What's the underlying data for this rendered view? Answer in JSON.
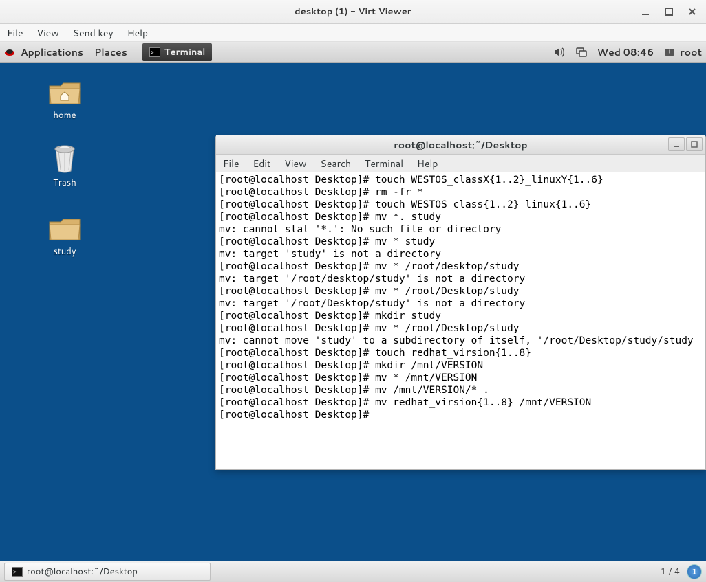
{
  "virt": {
    "title": "desktop (1) - Virt Viewer",
    "menu": [
      "File",
      "View",
      "Send key",
      "Help"
    ]
  },
  "gnome": {
    "apps": "Applications",
    "places": "Places",
    "task_terminal": "Terminal",
    "clock": "Wed 08:46",
    "user": "root"
  },
  "desktop_icons": [
    {
      "label": "home",
      "type": "home"
    },
    {
      "label": "Trash",
      "type": "trash"
    },
    {
      "label": "study",
      "type": "folder"
    }
  ],
  "terminal": {
    "title": "root@localhost:~/Desktop",
    "menu": [
      "File",
      "Edit",
      "View",
      "Search",
      "Terminal",
      "Help"
    ],
    "lines": [
      "[root@localhost Desktop]# touch WESTOS_classX{1..2}_linuxY{1..6}",
      "[root@localhost Desktop]# rm -fr *",
      "[root@localhost Desktop]# touch WESTOS_class{1..2}_linux{1..6}",
      "[root@localhost Desktop]# mv *. study",
      "mv: cannot stat '*.': No such file or directory",
      "[root@localhost Desktop]# mv * study",
      "mv: target 'study' is not a directory",
      "[root@localhost Desktop]# mv * /root/desktop/study",
      "mv: target '/root/desktop/study' is not a directory",
      "[root@localhost Desktop]# mv * /root/Desktop/study",
      "mv: target '/root/Desktop/study' is not a directory",
      "[root@localhost Desktop]# mkdir study",
      "[root@localhost Desktop]# mv * /root/Desktop/study",
      "mv: cannot move 'study' to a subdirectory of itself, '/root/Desktop/study/study",
      "[root@localhost Desktop]# touch redhat_virsion{1..8}",
      "[root@localhost Desktop]# mkdir /mnt/VERSION",
      "[root@localhost Desktop]# mv * /mnt/VERSION",
      "[root@localhost Desktop]# mv /mnt/VERSION/* .",
      "[root@localhost Desktop]# mv redhat_virsion{1..8} /mnt/VERSION",
      "[root@localhost Desktop]# "
    ]
  },
  "bottom": {
    "task": "root@localhost:~/Desktop",
    "workspace_text": "1 / 4",
    "workspace_num": "1"
  }
}
